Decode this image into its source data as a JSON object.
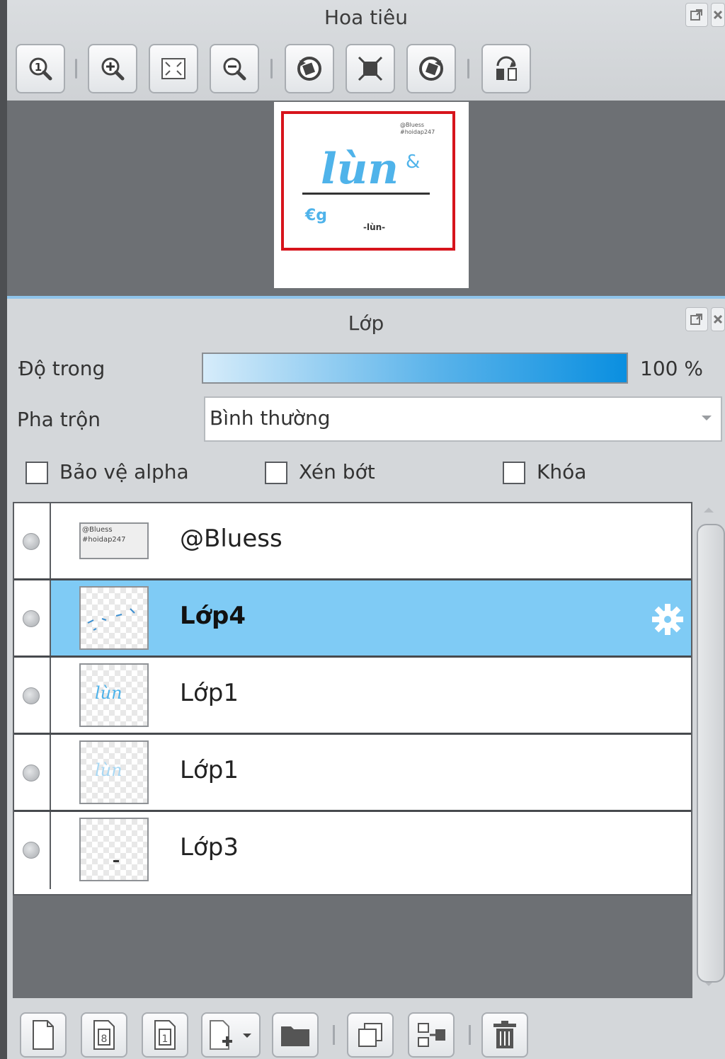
{
  "navigator": {
    "title": "Hoa tiêu",
    "toolbar": [
      "zoom-actual-icon",
      "zoom-in-icon",
      "fit-screen-icon",
      "zoom-out-icon",
      "rotate-left-icon",
      "reset-view-icon",
      "rotate-right-icon",
      "flip-icon"
    ],
    "preview_text": {
      "watermark_line1": "@Bluess",
      "watermark_line2": "#hoidap247",
      "main": "lùn",
      "small": "-lùn-",
      "left": "€g",
      "right": "&"
    }
  },
  "layers_panel": {
    "title": "Lớp",
    "opacity_label": "Độ trong",
    "opacity_value": "100 %",
    "opacity_fraction": 1.0,
    "blend_label": "Pha trộn",
    "blend_value": "Bình thường",
    "checkboxes": [
      {
        "label": "Bảo vệ alpha",
        "checked": false
      },
      {
        "label": "Xén bớt",
        "checked": false
      },
      {
        "label": "Khóa",
        "checked": false
      }
    ],
    "layers": [
      {
        "name": "@Bluess",
        "selected": false,
        "thumb_line1": "@Bluess",
        "thumb_line2": "#hoidap247"
      },
      {
        "name": "Lớp4",
        "selected": true
      },
      {
        "name": "Lớp1",
        "selected": false,
        "thumb_text": "lùn"
      },
      {
        "name": "Lớp1",
        "selected": false,
        "thumb_text": "lùn"
      },
      {
        "name": "Lớp3",
        "selected": false
      }
    ],
    "bottom_toolbar": [
      "new-layer-icon",
      "new-8bit-layer-icon",
      "new-1bit-layer-icon",
      "add-layer-dropdown-icon",
      "new-folder-icon",
      "duplicate-layer-icon",
      "merge-down-icon",
      "delete-layer-icon"
    ]
  },
  "colors": {
    "selection": "#7fcbf5",
    "preview_frame": "#d7141c",
    "accent": "#1a9be6"
  }
}
